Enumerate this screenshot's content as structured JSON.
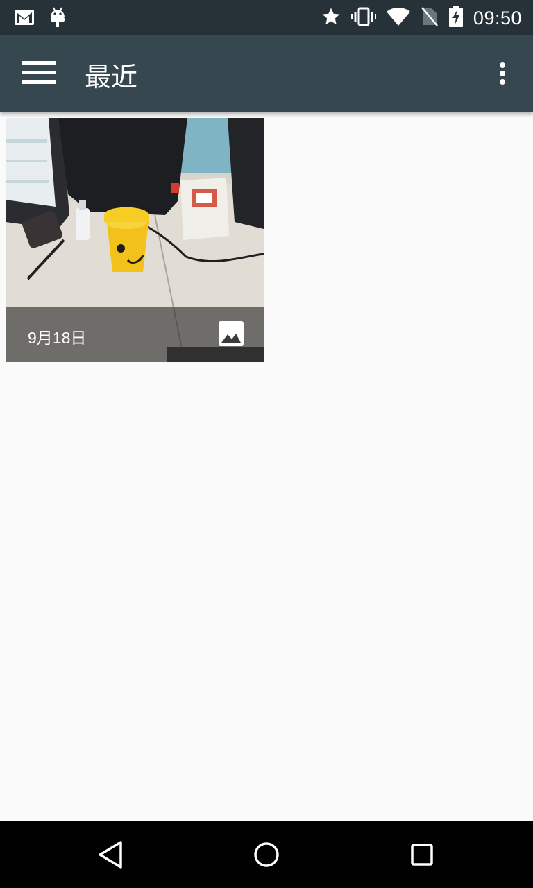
{
  "status_bar": {
    "time": "09:50",
    "left_icons": [
      "gmail-icon",
      "android-debug-icon"
    ],
    "right_icons": [
      "star-icon",
      "vibrate-icon",
      "wifi-icon",
      "no-sim-icon",
      "battery-charging-icon"
    ]
  },
  "app_bar": {
    "title": "最近",
    "menu_icon": "hamburger-menu-icon",
    "overflow_icon": "more-vert-icon",
    "background": "#37474f"
  },
  "grid": {
    "items": [
      {
        "date": "9月18日",
        "type_icon": "image-icon"
      }
    ]
  },
  "nav_bar": {
    "buttons": [
      "back-icon",
      "home-icon",
      "recents-icon"
    ]
  },
  "colors": {
    "status_bar": "#263238",
    "app_bar": "#37474f",
    "content_bg": "#fafafa",
    "nav_bar": "#000000"
  }
}
